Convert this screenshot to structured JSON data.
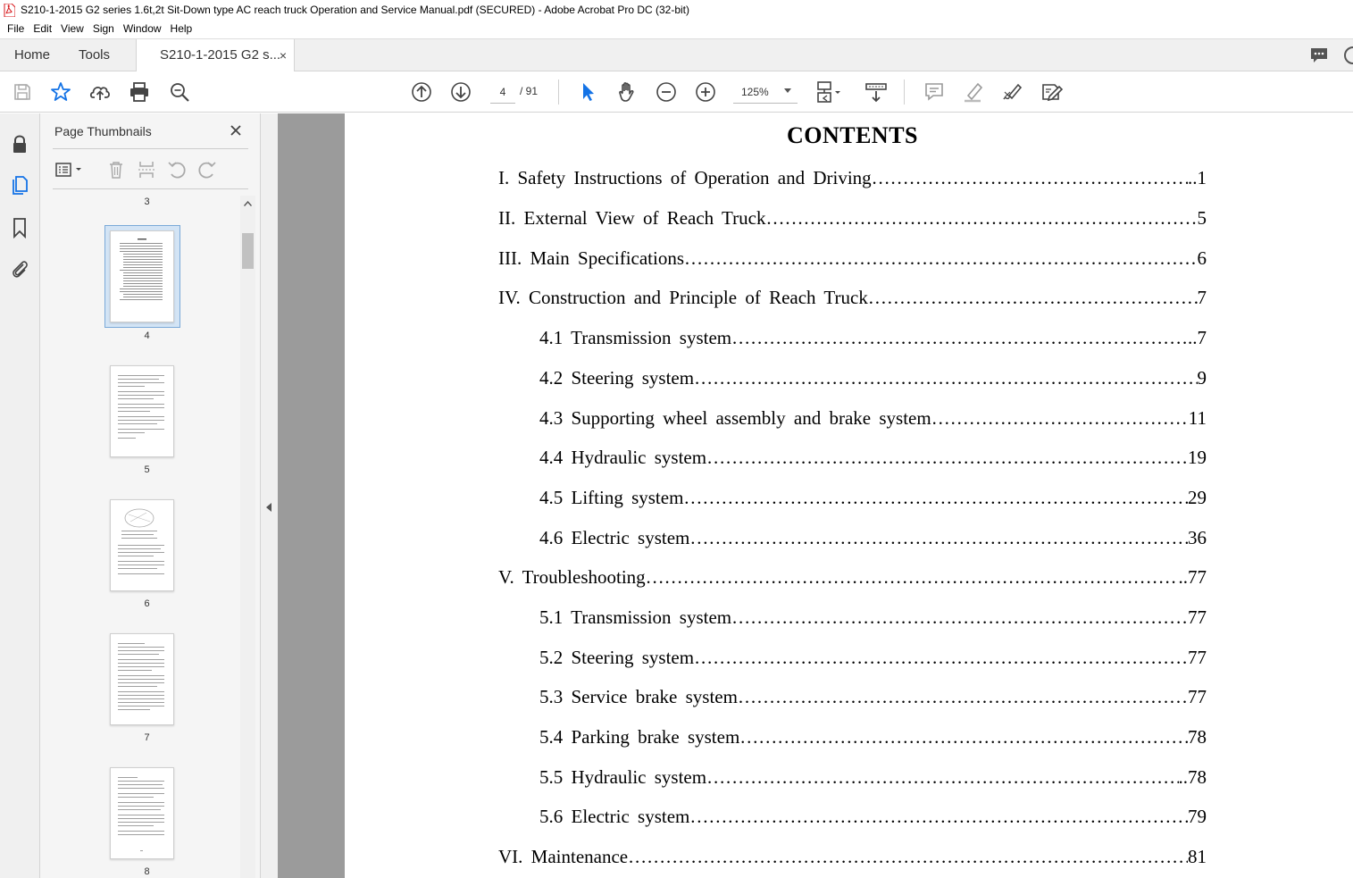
{
  "window": {
    "title": "S210-1-2015 G2 series 1.6t,2t Sit-Down type AC reach truck Operation and Service Manual.pdf (SECURED) - Adobe Acrobat Pro DC (32-bit)"
  },
  "menu": [
    "File",
    "Edit",
    "View",
    "Sign",
    "Window",
    "Help"
  ],
  "tabs": {
    "home": "Home",
    "tools": "Tools",
    "document": "S210-1-2015 G2 s...",
    "close_glyph": "×"
  },
  "toolbar": {
    "current_page": "4",
    "total_pages": "/ 91",
    "zoom": "125%"
  },
  "thumbnails": {
    "title": "Page Thumbnails",
    "pages": [
      "3",
      "4",
      "5",
      "6",
      "7",
      "8"
    ],
    "selected_page": "4"
  },
  "document": {
    "heading": "CONTENTS",
    "entries": [
      {
        "title": "I. Safety Instructions of Operation and Driving",
        "page": "..1",
        "level": 1
      },
      {
        "title": "II. External View of Reach Truck",
        "page": "5",
        "level": 1
      },
      {
        "title": "III. Main Specifications",
        "page": "6",
        "level": 1
      },
      {
        "title": "IV. Construction and Principle of Reach Truck",
        "page": "7",
        "level": 1
      },
      {
        "title": "4.1  Transmission  system",
        "page": "..7",
        "level": 2
      },
      {
        "title": "4.2 Steering system",
        "page": "9",
        "level": 2
      },
      {
        "title": "4.3 Supporting wheel assembly and brake system",
        "page": "11",
        "level": 2
      },
      {
        "title": "4.4 Hydraulic system",
        "page": "19",
        "level": 2
      },
      {
        "title": "4.5 Lifting system",
        "page": "29",
        "level": 2
      },
      {
        "title": "4.6 Electric system",
        "page": "36",
        "level": 2
      },
      {
        "title": "V.  Troubleshooting",
        "page": "..77",
        "level": 1
      },
      {
        "title": "5.1  Transmission  system",
        "page": "77",
        "level": 2
      },
      {
        "title": "5.2  Steering  system",
        "page": "77",
        "level": 2
      },
      {
        "title": "5.3  Service  brake  system",
        "page": "77",
        "level": 2
      },
      {
        "title": "5.4  Parking  brake  system",
        "page": "78",
        "level": 2
      },
      {
        "title": "5.5  Hydraulic  system",
        "page": "..78",
        "level": 2
      },
      {
        "title": "5.6  Electric  system",
        "page": "79",
        "level": 2
      },
      {
        "title": "VI.  Maintenance",
        "page": "81",
        "level": 1
      }
    ]
  },
  "colors": {
    "accent_blue": "#1473e6",
    "selection_blue": "#7aa9d8",
    "doc_background": "#9b9b9b",
    "pdf_red": "#d7191c"
  }
}
